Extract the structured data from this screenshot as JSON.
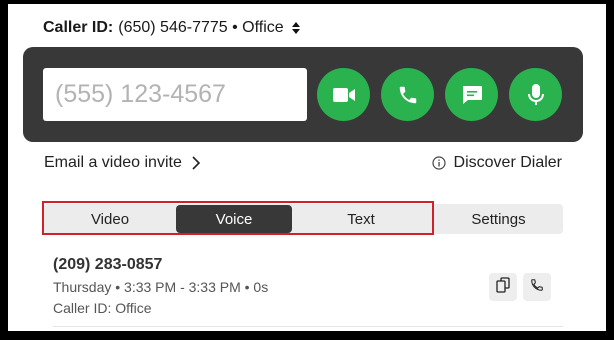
{
  "caller_id": {
    "label": "Caller ID:",
    "value": "(650) 546-7775 • Office"
  },
  "dialer": {
    "placeholder": "(555) 123-4567",
    "button_color": "#2ab24f",
    "buttons": [
      {
        "name": "video-call-button",
        "icon": "video-camera-icon"
      },
      {
        "name": "voice-call-button",
        "icon": "phone-icon"
      },
      {
        "name": "text-message-button",
        "icon": "chat-bubble-icon"
      },
      {
        "name": "microphone-button",
        "icon": "microphone-icon"
      }
    ]
  },
  "links": {
    "email_invite": "Email a video invite",
    "discover_dialer": "Discover Dialer"
  },
  "tabs": {
    "items": [
      "Video",
      "Voice",
      "Text",
      "Settings"
    ],
    "active": "Voice"
  },
  "highlight_color": "#d0202a",
  "recent_call": {
    "number": "(209) 283-0857",
    "meta": "Thursday • 3:33 PM - 3:33 PM • 0s",
    "caller_id": "Caller ID: Office"
  }
}
